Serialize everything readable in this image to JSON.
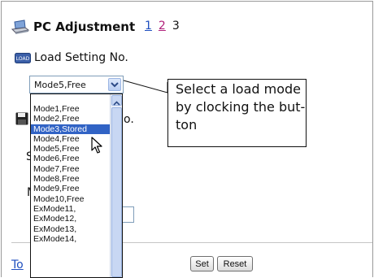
{
  "header": {
    "title": "PC Adjustment",
    "pages": {
      "p1": "1",
      "p2": "2",
      "current": "3"
    }
  },
  "load_section": {
    "label": "Load Setting No."
  },
  "mode_select": {
    "selected": "Mode5,Free",
    "options": [
      "Mode1,Free",
      "Mode2,Free",
      "Mode3,Stored",
      "Mode4,Free",
      "Mode5,Free",
      "Mode6,Free",
      "Mode7,Free",
      "Mode8,Free",
      "Mode9,Free",
      "Mode10,Free",
      "ExMode11,",
      "ExMode12,",
      "ExMode13,",
      "ExMode14,"
    ],
    "highlighted": "Mode3,Stored"
  },
  "hidden_fragments": {
    "save_suffix": "o.",
    "s_frag": "S",
    "m_frag": "M",
    "top_link": "To"
  },
  "callout": {
    "text": "Select a load mode by clocking the but-ton"
  },
  "callout_lines": [
    "Select a load mode",
    "by clocking the but-",
    "ton"
  ],
  "buttons": {
    "set": "Set",
    "reset": "Reset"
  },
  "icons": {
    "title": "pc-printer-icon",
    "load": "load-icon",
    "save": "floppy-disk-icon",
    "cursor": "mouse-pointer-icon"
  },
  "colors": {
    "highlight": "#3163c5",
    "link1": "#1f4fbf",
    "link2": "#b0207a"
  }
}
